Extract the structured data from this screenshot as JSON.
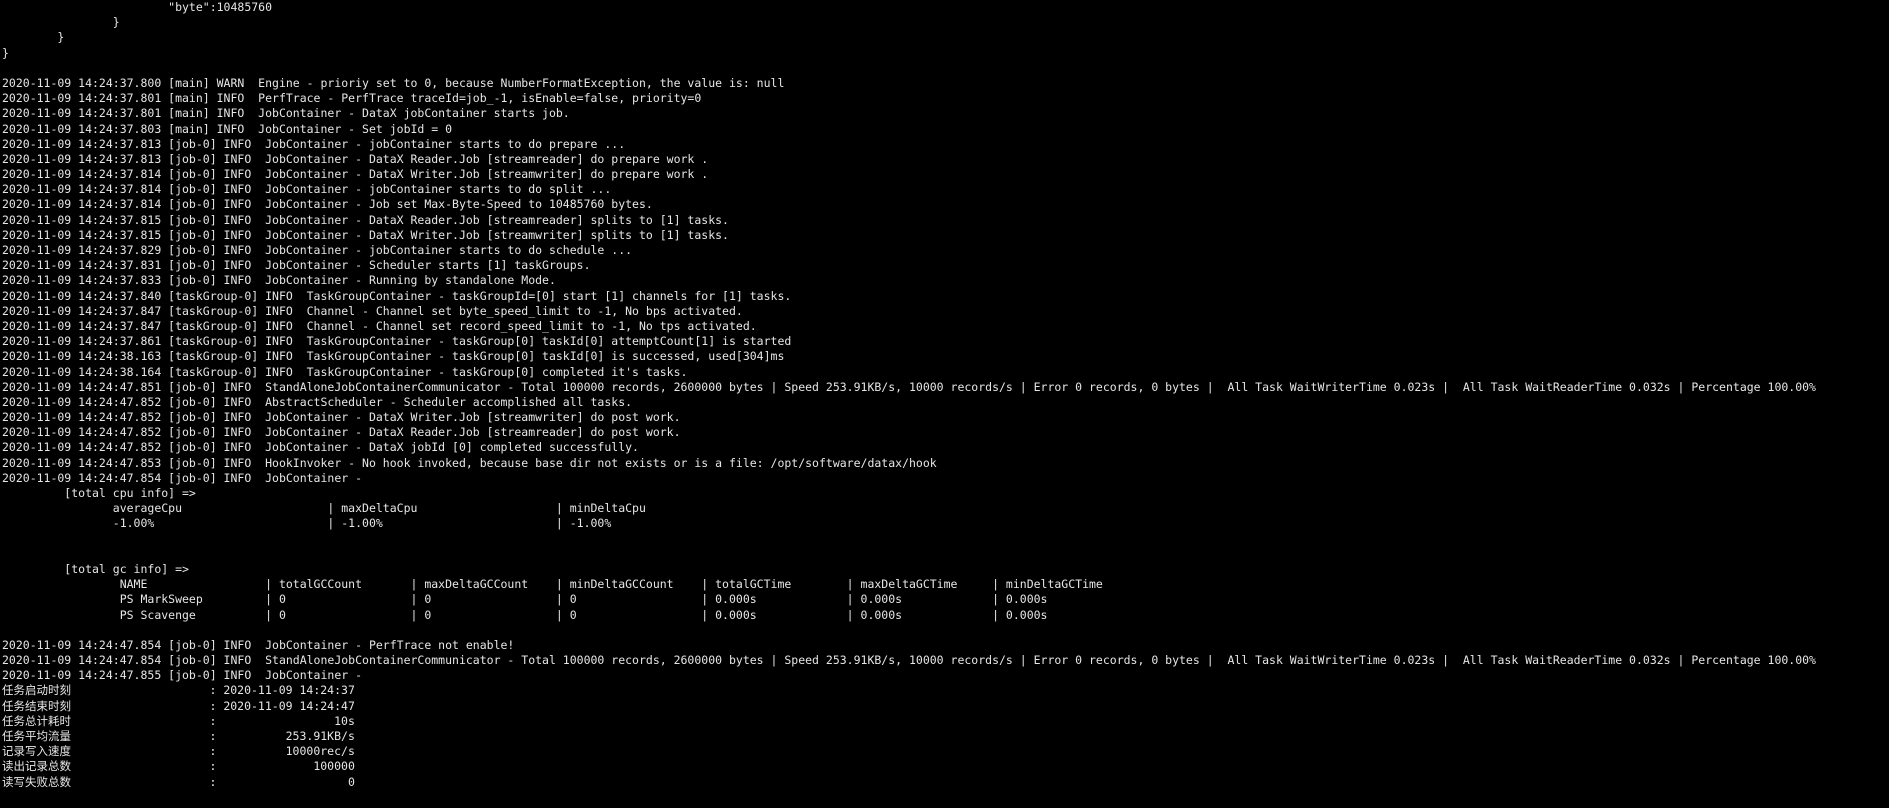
{
  "terminal": {
    "lines": [
      "                        \"byte\":10485760",
      "                }",
      "        }",
      "}",
      "",
      "2020-11-09 14:24:37.800 [main] WARN  Engine - prioriy set to 0, because NumberFormatException, the value is: null",
      "2020-11-09 14:24:37.801 [main] INFO  PerfTrace - PerfTrace traceId=job_-1, isEnable=false, priority=0",
      "2020-11-09 14:24:37.801 [main] INFO  JobContainer - DataX jobContainer starts job.",
      "2020-11-09 14:24:37.803 [main] INFO  JobContainer - Set jobId = 0",
      "2020-11-09 14:24:37.813 [job-0] INFO  JobContainer - jobContainer starts to do prepare ...",
      "2020-11-09 14:24:37.813 [job-0] INFO  JobContainer - DataX Reader.Job [streamreader] do prepare work .",
      "2020-11-09 14:24:37.814 [job-0] INFO  JobContainer - DataX Writer.Job [streamwriter] do prepare work .",
      "2020-11-09 14:24:37.814 [job-0] INFO  JobContainer - jobContainer starts to do split ...",
      "2020-11-09 14:24:37.814 [job-0] INFO  JobContainer - Job set Max-Byte-Speed to 10485760 bytes.",
      "2020-11-09 14:24:37.815 [job-0] INFO  JobContainer - DataX Reader.Job [streamreader] splits to [1] tasks.",
      "2020-11-09 14:24:37.815 [job-0] INFO  JobContainer - DataX Writer.Job [streamwriter] splits to [1] tasks.",
      "2020-11-09 14:24:37.829 [job-0] INFO  JobContainer - jobContainer starts to do schedule ...",
      "2020-11-09 14:24:37.831 [job-0] INFO  JobContainer - Scheduler starts [1] taskGroups.",
      "2020-11-09 14:24:37.833 [job-0] INFO  JobContainer - Running by standalone Mode.",
      "2020-11-09 14:24:37.840 [taskGroup-0] INFO  TaskGroupContainer - taskGroupId=[0] start [1] channels for [1] tasks.",
      "2020-11-09 14:24:37.847 [taskGroup-0] INFO  Channel - Channel set byte_speed_limit to -1, No bps activated.",
      "2020-11-09 14:24:37.847 [taskGroup-0] INFO  Channel - Channel set record_speed_limit to -1, No tps activated.",
      "2020-11-09 14:24:37.861 [taskGroup-0] INFO  TaskGroupContainer - taskGroup[0] taskId[0] attemptCount[1] is started",
      "2020-11-09 14:24:38.163 [taskGroup-0] INFO  TaskGroupContainer - taskGroup[0] taskId[0] is successed, used[304]ms",
      "2020-11-09 14:24:38.164 [taskGroup-0] INFO  TaskGroupContainer - taskGroup[0] completed it's tasks.",
      "2020-11-09 14:24:47.851 [job-0] INFO  StandAloneJobContainerCommunicator - Total 100000 records, 2600000 bytes | Speed 253.91KB/s, 10000 records/s | Error 0 records, 0 bytes |  All Task WaitWriterTime 0.023s |  All Task WaitReaderTime 0.032s | Percentage 100.00%",
      "2020-11-09 14:24:47.852 [job-0] INFO  AbstractScheduler - Scheduler accomplished all tasks.",
      "2020-11-09 14:24:47.852 [job-0] INFO  JobContainer - DataX Writer.Job [streamwriter] do post work.",
      "2020-11-09 14:24:47.852 [job-0] INFO  JobContainer - DataX Reader.Job [streamreader] do post work.",
      "2020-11-09 14:24:47.852 [job-0] INFO  JobContainer - DataX jobId [0] completed successfully.",
      "2020-11-09 14:24:47.853 [job-0] INFO  HookInvoker - No hook invoked, because base dir not exists or is a file: /opt/software/datax/hook",
      "2020-11-09 14:24:47.854 [job-0] INFO  JobContainer - ",
      "         [total cpu info] => ",
      "                averageCpu                     | maxDeltaCpu                    | minDeltaCpu                    ",
      "                -1.00%                         | -1.00%                         | -1.00%",
      "",
      "",
      "         [total gc info] => ",
      "                 NAME                 | totalGCCount       | maxDeltaGCCount    | minDeltaGCCount    | totalGCTime        | maxDeltaGCTime     | minDeltaGCTime     ",
      "                 PS MarkSweep         | 0                  | 0                  | 0                  | 0.000s             | 0.000s             | 0.000s             ",
      "                 PS Scavenge          | 0                  | 0                  | 0                  | 0.000s             | 0.000s             | 0.000s             ",
      "",
      "2020-11-09 14:24:47.854 [job-0] INFO  JobContainer - PerfTrace not enable!",
      "2020-11-09 14:24:47.854 [job-0] INFO  StandAloneJobContainerCommunicator - Total 100000 records, 2600000 bytes | Speed 253.91KB/s, 10000 records/s | Error 0 records, 0 bytes |  All Task WaitWriterTime 0.023s |  All Task WaitReaderTime 0.032s | Percentage 100.00%",
      "2020-11-09 14:24:47.855 [job-0] INFO  JobContainer - ",
      "任务启动时刻                    : 2020-11-09 14:24:37",
      "任务结束时刻                    : 2020-11-09 14:24:47",
      "任务总计耗时                    :                 10s",
      "任务平均流量                    :          253.91KB/s",
      "记录写入速度                    :          10000rec/s",
      "读出记录总数                    :              100000",
      "读写失败总数                    :                   0"
    ]
  }
}
